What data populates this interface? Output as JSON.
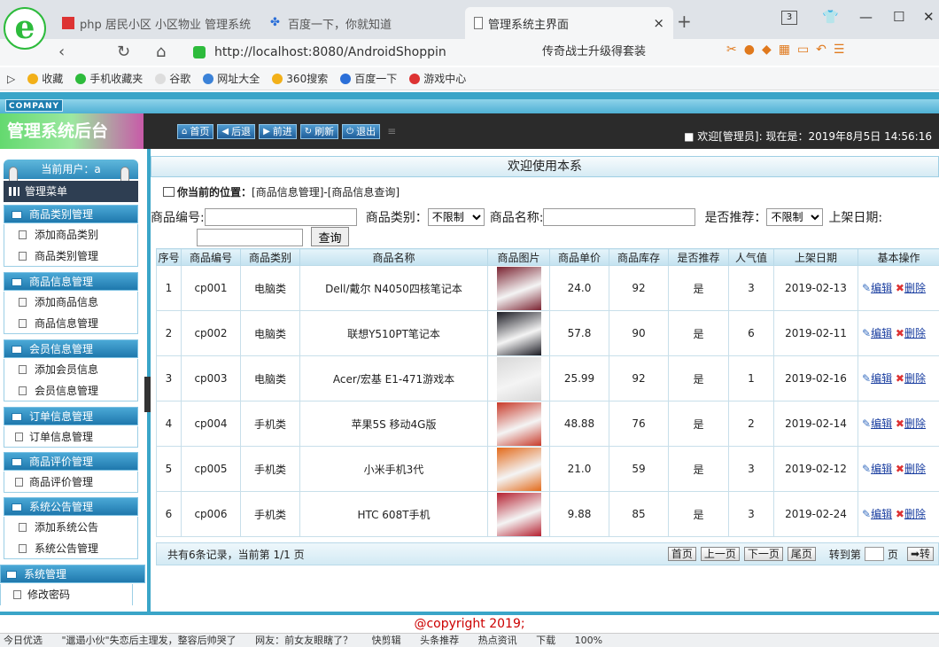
{
  "browser": {
    "logo_letter": "e",
    "tabs": [
      {
        "label": "php 居民小区 小区物业 管理系统"
      },
      {
        "label": "百度一下，你就知道"
      },
      {
        "label": "管理系统主界面",
        "close": "×"
      }
    ],
    "new_tab": "+",
    "tab_count": "3",
    "url": "http://localhost:8080/AndroidShoppin",
    "search_text": "传奇战士升级得套装",
    "bookmarks": [
      "收藏",
      "手机收藏夹",
      "谷歌",
      "网址大全",
      "360搜索",
      "百度一下",
      "游戏中心"
    ]
  },
  "app": {
    "company": "COMPANY",
    "title": "管理系统后台",
    "toolbar": [
      "首页",
      "后退",
      "前进",
      "刷新",
      "退出"
    ],
    "welcome": "■ 欢迎[管理员]: 现在是：2019年8月5日 14:56:16",
    "current_user": "当前用户：a",
    "menu_title": "管理菜单",
    "menu": [
      {
        "section": "商品类别管理",
        "items": [
          "添加商品类别",
          "商品类别管理"
        ]
      },
      {
        "section": "商品信息管理",
        "items": [
          "添加商品信息",
          "商品信息管理"
        ]
      },
      {
        "section": "会员信息管理",
        "items": [
          "添加会员信息",
          "会员信息管理"
        ]
      },
      {
        "section": "订单信息管理",
        "items": [
          "订单信息管理"
        ]
      },
      {
        "section": "商品评价管理",
        "items": [
          "商品评价管理"
        ]
      },
      {
        "section": "系统公告管理",
        "items": [
          "添加系统公告",
          "系统公告管理"
        ]
      },
      {
        "section": "系统管理",
        "items": [
          "修改密码"
        ]
      }
    ],
    "main_title": "欢迎使用本系",
    "location_label": "你当前的位置：",
    "location_path": "[商品信息管理]-[商品信息查询]",
    "search": {
      "code_label": "商品编号:",
      "type_label": "商品类别：",
      "type_value": "不限制",
      "name_label": "商品名称:",
      "recommend_label": "是否推荐：",
      "recommend_value": "不限制",
      "date_label": "上架日期:",
      "query_button": "查询"
    },
    "table": {
      "headers": [
        "序号",
        "商品编号",
        "商品类别",
        "商品名称",
        "商品图片",
        "商品单价",
        "商品库存",
        "是否推荐",
        "人气值",
        "上架日期",
        "基本操作"
      ],
      "edit_label": "编辑",
      "delete_label": "删除",
      "rows": [
        {
          "no": "1",
          "code": "cp001",
          "type": "电脑类",
          "name": "Dell/戴尔 N4050四核笔记本",
          "price": "24.0",
          "stock": "92",
          "recommend": "是",
          "popularity": "3",
          "date": "2019-02-13",
          "img_color": "#7a2230"
        },
        {
          "no": "2",
          "code": "cp002",
          "type": "电脑类",
          "name": "联想Y510PT笔记本",
          "price": "57.8",
          "stock": "90",
          "recommend": "是",
          "popularity": "6",
          "date": "2019-02-11",
          "img_color": "#1a1a22"
        },
        {
          "no": "3",
          "code": "cp003",
          "type": "电脑类",
          "name": "Acer/宏基 E1-471游戏本",
          "price": "25.99",
          "stock": "92",
          "recommend": "是",
          "popularity": "1",
          "date": "2019-02-16",
          "img_color": "#d8d8d8"
        },
        {
          "no": "4",
          "code": "cp004",
          "type": "手机类",
          "name": "苹果5S 移动4G版",
          "price": "48.88",
          "stock": "76",
          "recommend": "是",
          "popularity": "2",
          "date": "2019-02-14",
          "img_color": "#c83a2a"
        },
        {
          "no": "5",
          "code": "cp005",
          "type": "手机类",
          "name": "小米手机3代",
          "price": "21.0",
          "stock": "59",
          "recommend": "是",
          "popularity": "3",
          "date": "2019-02-12",
          "img_color": "#e36a1a"
        },
        {
          "no": "6",
          "code": "cp006",
          "type": "手机类",
          "name": "HTC 608T手机",
          "price": "9.88",
          "stock": "85",
          "recommend": "是",
          "popularity": "3",
          "date": "2019-02-24",
          "img_color": "#b52030"
        }
      ]
    },
    "pager": {
      "summary": "共有6条记录，当前第 1/1 页",
      "first": "首页",
      "prev": "上一页",
      "next": "下一页",
      "last": "尾页",
      "goto_label": "转到第",
      "page_label": "页",
      "go": "➡转"
    },
    "copyright": "@copyright 2019;"
  },
  "status_bar": [
    "今日优选",
    "\"邋遢小伙\"失恋后主理发，整容后帅哭了",
    "网友：前女友眼瞎了？",
    "快剪辑",
    "头条推荐",
    "热点资讯",
    "下载",
    "100%"
  ]
}
